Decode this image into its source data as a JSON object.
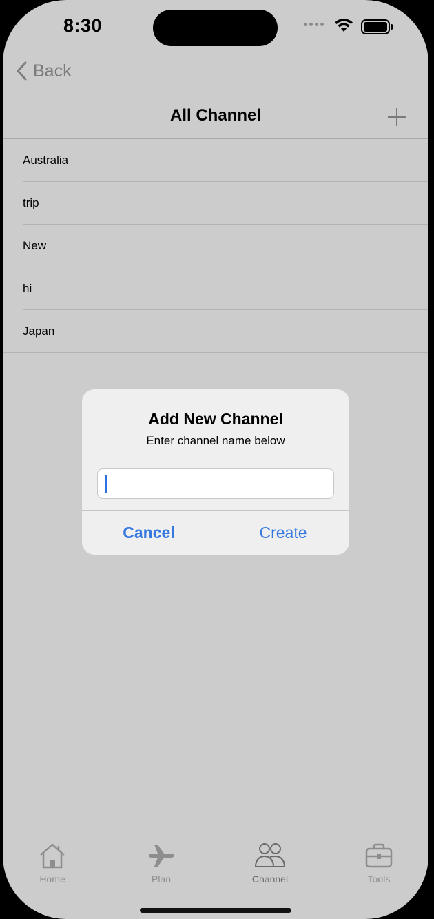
{
  "status": {
    "time": "8:30"
  },
  "nav": {
    "back_label": "Back",
    "title": "All Channel"
  },
  "channels": [
    "Australia",
    "trip",
    "New",
    "hi",
    "Japan"
  ],
  "dialog": {
    "title": "Add New Channel",
    "message": "Enter channel name below",
    "input_value": "",
    "cancel_label": "Cancel",
    "create_label": "Create"
  },
  "tabs": [
    {
      "label": "Home",
      "icon": "home-icon"
    },
    {
      "label": "Plan",
      "icon": "airplane-icon"
    },
    {
      "label": "Channel",
      "icon": "people-icon",
      "active": true
    },
    {
      "label": "Tools",
      "icon": "briefcase-icon"
    }
  ],
  "colors": {
    "accent": "#3478e0",
    "background": "#cccccc",
    "dialog": "#efefef"
  }
}
